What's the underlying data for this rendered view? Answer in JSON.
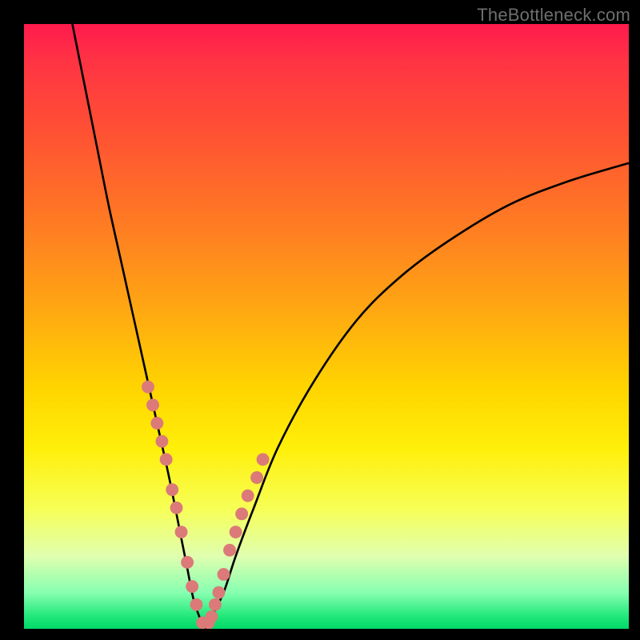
{
  "watermark": "TheBottleneck.com",
  "chart_data": {
    "type": "line",
    "title": "",
    "xlabel": "",
    "ylabel": "",
    "xlim": [
      0,
      100
    ],
    "ylim": [
      0,
      100
    ],
    "grid": false,
    "legend": false,
    "series": [
      {
        "name": "bottleneck-curve",
        "color": "#000000",
        "x": [
          8,
          10,
          12,
          14,
          16,
          18,
          20,
          22,
          24,
          26,
          27,
          28,
          29,
          30,
          31,
          33,
          35,
          38,
          42,
          48,
          55,
          62,
          70,
          80,
          90,
          100
        ],
        "y": [
          100,
          90,
          80,
          70,
          61,
          52,
          43,
          34,
          25,
          15,
          10,
          5,
          2,
          0,
          2,
          6,
          12,
          20,
          30,
          41,
          51,
          58,
          64,
          70,
          74,
          77
        ]
      }
    ],
    "markers": {
      "name": "highlight-dots",
      "color": "#db7a78",
      "x": [
        20.5,
        21.3,
        22.0,
        22.8,
        23.5,
        24.5,
        25.2,
        26.0,
        27.0,
        27.8,
        28.5,
        29.5,
        30.5,
        31.0,
        31.6,
        32.2,
        33.0,
        34.0,
        35.0,
        36.0,
        37.0,
        38.5,
        39.5
      ],
      "y": [
        40,
        37,
        34,
        31,
        28,
        23,
        20,
        16,
        11,
        7,
        4,
        1,
        1,
        2,
        4,
        6,
        9,
        13,
        16,
        19,
        22,
        25,
        28
      ]
    }
  }
}
